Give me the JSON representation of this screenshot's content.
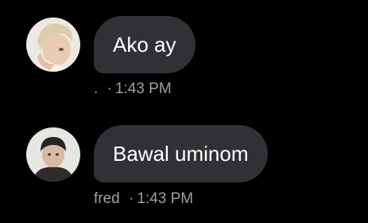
{
  "messages": [
    {
      "avatar": "user-avatar-photo",
      "text": "Ako ay",
      "sender": ".",
      "separator": "·",
      "time": "1:43 PM"
    },
    {
      "avatar": "user-avatar-photo",
      "text": "Bawal uminom",
      "sender": "fred",
      "separator": "·",
      "time": "1:43 PM"
    }
  ],
  "colors": {
    "background": "#000000",
    "bubble": "#303134",
    "bubble_text": "#ffffff",
    "meta_text": "#9aa0a6"
  }
}
